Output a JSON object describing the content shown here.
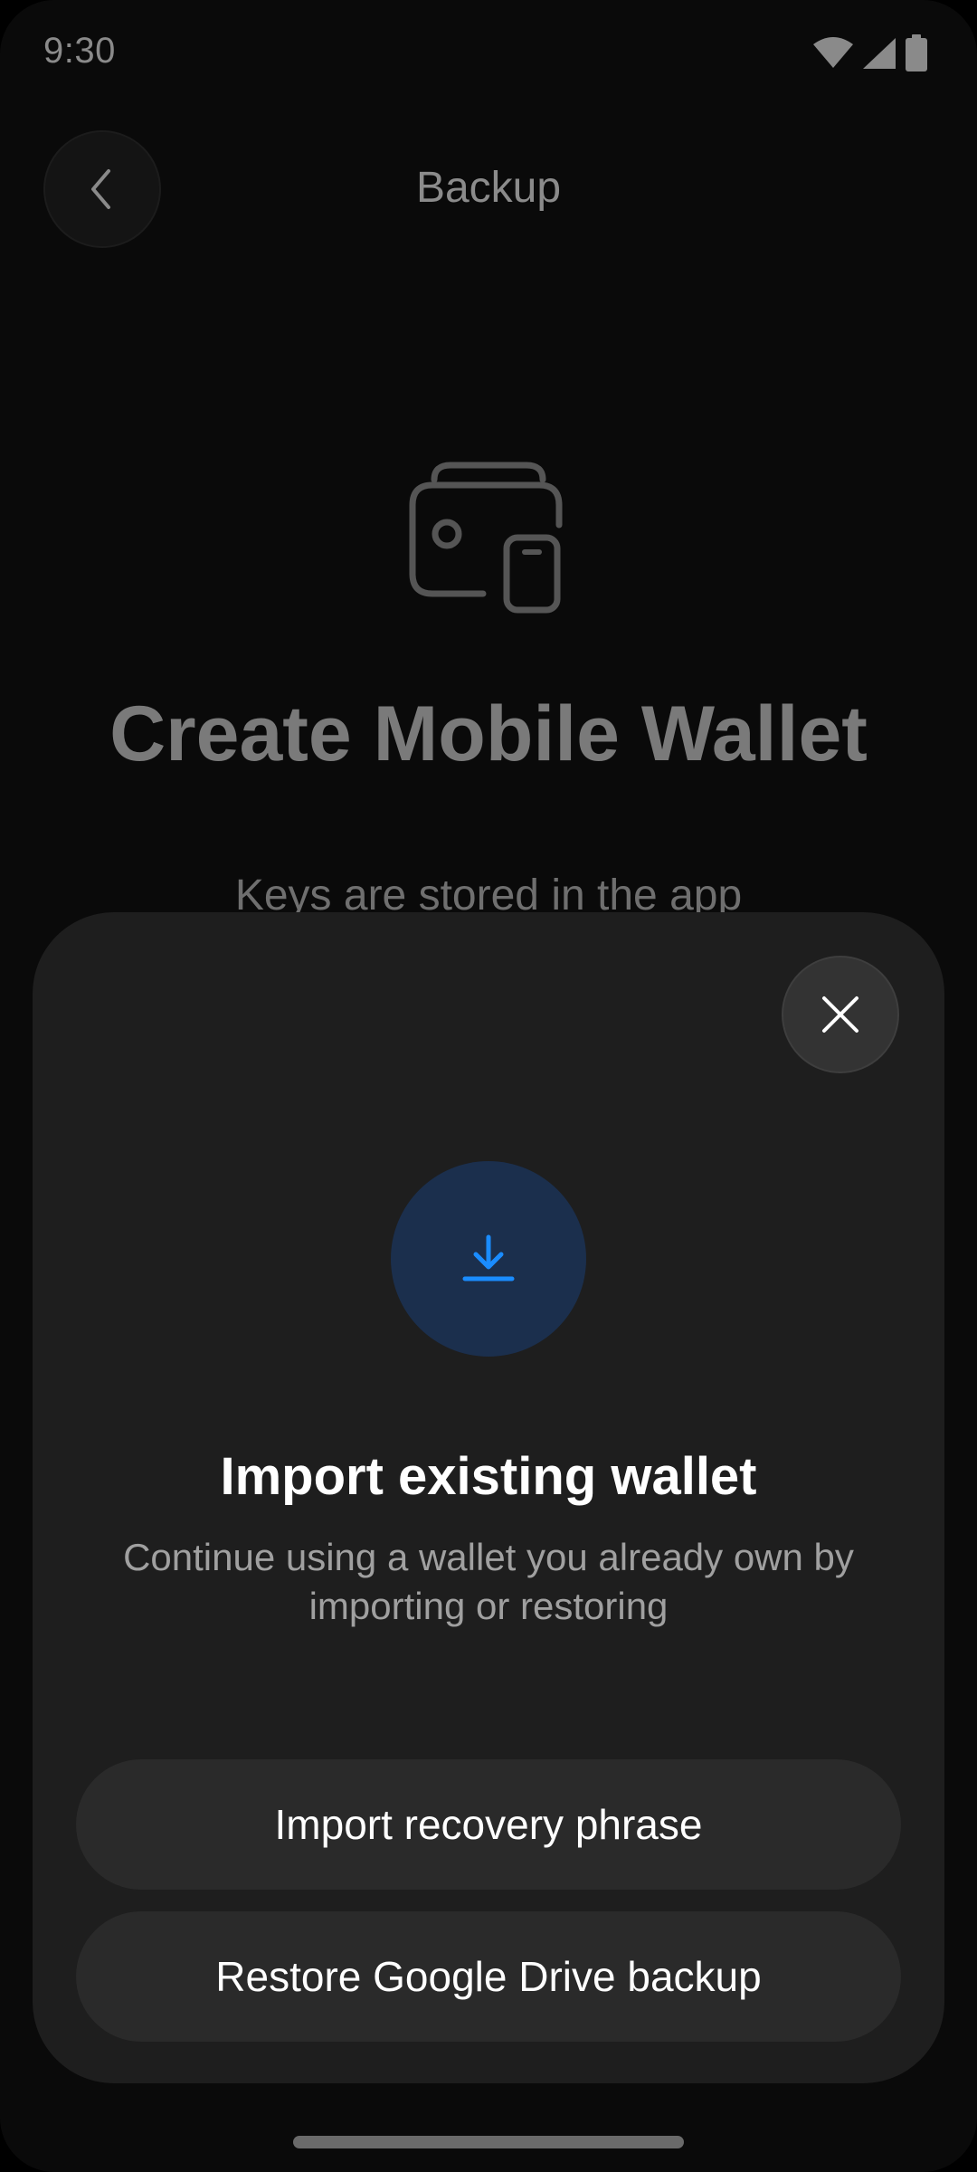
{
  "status_bar": {
    "time": "9:30",
    "icons": [
      "wifi-icon",
      "cellular-signal-icon",
      "battery-icon"
    ]
  },
  "header": {
    "title": "Backup",
    "back_icon": "chevron-left-icon"
  },
  "background": {
    "hero_icon": "wallet-phone-icon",
    "title": "Create Mobile Wallet",
    "subtitle": "Keys are stored in the app"
  },
  "sheet": {
    "close_icon": "close-icon",
    "import_icon": "download-icon",
    "title": "Import existing wallet",
    "description": "Continue using a wallet you already own by importing or restoring",
    "buttons": {
      "import_label": "Import recovery phrase",
      "restore_label": "Restore Google Drive backup"
    }
  },
  "colors": {
    "accent": "#1a8cff",
    "sheet_bg": "#1e1e1e",
    "button_bg": "#2a2a2a"
  }
}
